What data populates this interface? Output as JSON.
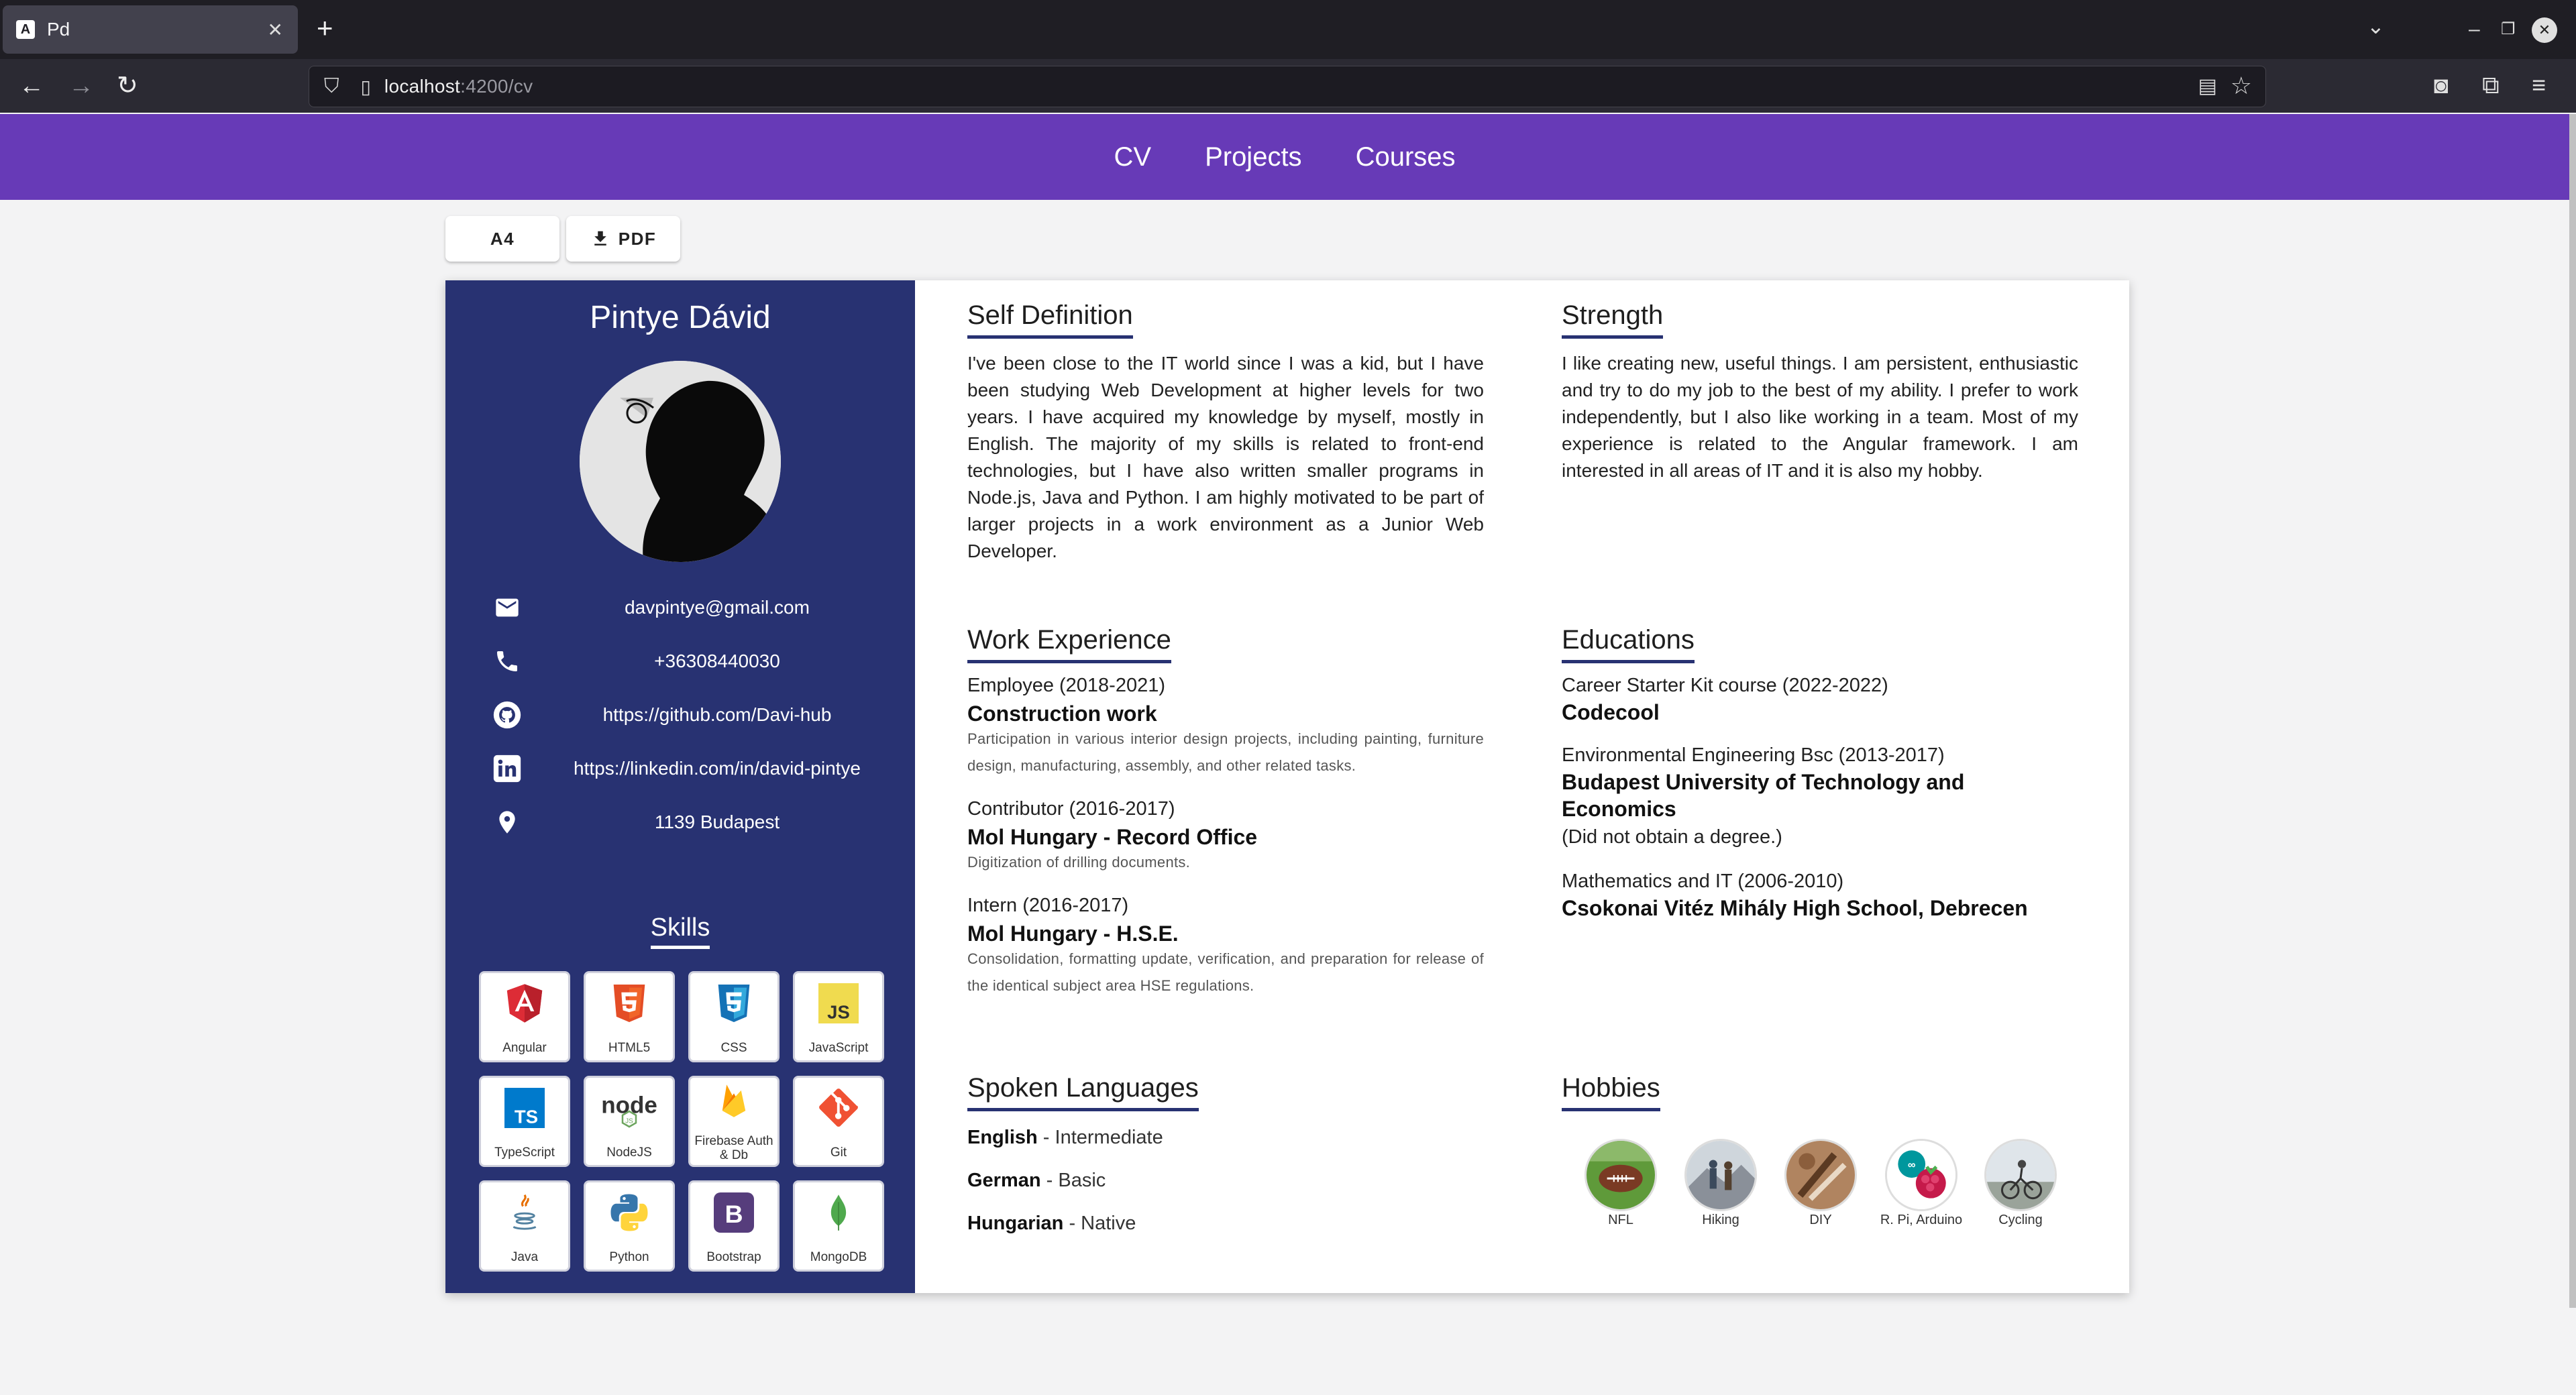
{
  "browser": {
    "tab_title": "Pd",
    "tab_favicon": "A",
    "url_host": "localhost",
    "url_rest": ":4200/cv"
  },
  "header": {
    "nav": [
      {
        "label": "CV"
      },
      {
        "label": "Projects"
      },
      {
        "label": "Courses"
      }
    ],
    "color": "#673ab7"
  },
  "toolbar": {
    "a4_label": "A4",
    "pdf_label": "PDF"
  },
  "sidebar": {
    "color": "#283272",
    "name": "Pintye Dávid",
    "contacts": [
      {
        "icon": "email-icon",
        "text": "davpintye@gmail.com"
      },
      {
        "icon": "phone-icon",
        "text": "+36308440030"
      },
      {
        "icon": "github-icon",
        "text": "https://github.com/Davi-hub"
      },
      {
        "icon": "linkedin-icon",
        "text": "https://linkedin.com/in/david-pintye"
      },
      {
        "icon": "location-pin-icon",
        "text": "1139 Budapest"
      }
    ],
    "skills_title": "Skills",
    "skills": [
      {
        "label": "Angular"
      },
      {
        "label": "HTML5"
      },
      {
        "label": "CSS"
      },
      {
        "label": "JavaScript"
      },
      {
        "label": "TypeScript"
      },
      {
        "label": "NodeJS"
      },
      {
        "label": "Firebase Auth & Db"
      },
      {
        "label": "Git"
      },
      {
        "label": "Java"
      },
      {
        "label": "Python"
      },
      {
        "label": "Bootstrap"
      },
      {
        "label": "MongoDB"
      }
    ]
  },
  "self_definition": {
    "title": "Self Definition",
    "text": "I've been close to the IT world since I was a kid, but I have been studying Web Development at higher levels for two years. I have acquired my knowledge by myself, mostly in English. The majority of my skills is related to front-end technologies, but I have also written smaller programs in Node.js, Java and Python. I am highly motivated to be part of larger projects in a work environment as a Junior Web Developer."
  },
  "strength": {
    "title": "Strength",
    "text": "I like creating new, useful things. I am persistent, enthusiastic and try to do my job to the best of my ability. I prefer to work independently, but I also like working in a team. Most of my experience is related to the Angular framework. I am interested in all areas of IT and it is also my hobby."
  },
  "work": {
    "title": "Work Experience",
    "items": [
      {
        "period": "Employee (2018-2021)",
        "title": "Construction work",
        "desc": "Participation in various interior design projects, including painting, furniture design, manufacturing, assembly, and other related tasks."
      },
      {
        "period": "Contributor (2016-2017)",
        "title": "Mol Hungary - Record Office",
        "desc": "Digitization of drilling documents."
      },
      {
        "period": "Intern (2016-2017)",
        "title": "Mol Hungary - H.S.E.",
        "desc": "Consolidation, formatting update, verification, and preparation for release of the identical subject area HSE regulations."
      }
    ]
  },
  "education": {
    "title": "Educations",
    "items": [
      {
        "period": "Career Starter Kit course (2022-2022)",
        "school": "Codecool",
        "note": ""
      },
      {
        "period": "Environmental Engineering Bsc (2013-2017)",
        "school": "Budapest University of Technology and Economics",
        "note": "(Did not obtain a degree.)"
      },
      {
        "period": "Mathematics and IT (2006-2010)",
        "school": "Csokonai Vitéz Mihály High School, Debrecen",
        "note": ""
      }
    ]
  },
  "languages": {
    "title": "Spoken Languages",
    "items": [
      {
        "name": "English",
        "level": " - Intermediate"
      },
      {
        "name": "German",
        "level": " - Basic"
      },
      {
        "name": "Hungarian",
        "level": " - Native"
      }
    ]
  },
  "hobbies": {
    "title": "Hobbies",
    "items": [
      {
        "label": "NFL"
      },
      {
        "label": "Hiking"
      },
      {
        "label": "DIY"
      },
      {
        "label": "R. Pi, Arduino"
      },
      {
        "label": "Cycling"
      }
    ]
  }
}
